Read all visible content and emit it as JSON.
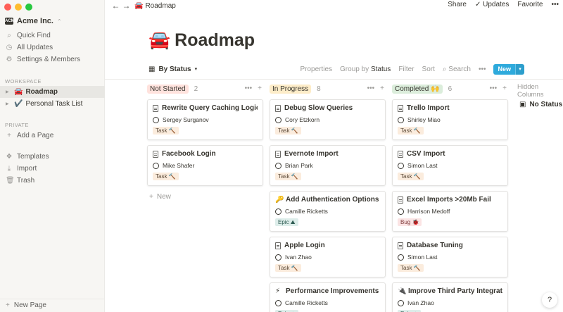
{
  "window": {
    "traffic_colors": [
      "#ff5f57",
      "#febc2e",
      "#28c840"
    ]
  },
  "workspace": {
    "logo": "ACME",
    "name": "Acme Inc.",
    "caret": "⌃"
  },
  "sidebar": {
    "top_items": [
      {
        "icon": "search-icon",
        "glyph": "⌕",
        "label": "Quick Find"
      },
      {
        "icon": "clock-icon",
        "glyph": "◷",
        "label": "All Updates"
      },
      {
        "icon": "gear-icon",
        "glyph": "⚙",
        "label": "Settings & Members"
      }
    ],
    "workspace_label": "WORKSPACE",
    "pages": [
      {
        "emoji": "🚘",
        "label": "Roadmap",
        "active": true
      },
      {
        "emoji": "✔️",
        "label": "Personal Task List",
        "active": false
      }
    ],
    "private_label": "PRIVATE",
    "add_page": "Add a Page",
    "bottom_items": [
      {
        "icon": "templates-icon",
        "glyph": "❖",
        "label": "Templates"
      },
      {
        "icon": "import-icon",
        "glyph": "⤓",
        "label": "Import"
      },
      {
        "icon": "trash-icon",
        "glyph": "🗑",
        "label": "Trash"
      }
    ],
    "new_page": "New Page"
  },
  "topbar": {
    "back": "←",
    "forward": "→",
    "crumb_emoji": "🚘",
    "crumb_label": "Roadmap",
    "share": "Share",
    "updates": "Updates",
    "favorite": "Favorite",
    "more": "•••"
  },
  "page": {
    "emoji": "🚘",
    "title": "Roadmap"
  },
  "view": {
    "tab_label": "By Status",
    "properties": "Properties",
    "group_by_prefix": "Group by",
    "group_by_value": "Status",
    "filter": "Filter",
    "sort": "Sort",
    "search": "Search",
    "more": "•••",
    "new": "New",
    "new_caret": "▾"
  },
  "columns": [
    {
      "name": "Not Started",
      "bg": "#ffe2dd",
      "count": "2",
      "cards": [
        {
          "icon": "doc",
          "title": "Rewrite Query Caching Logic",
          "person": "Sergey Surganov",
          "tag": "Task 🔨",
          "tag_type": "task"
        },
        {
          "icon": "doc",
          "title": "Facebook Login",
          "person": "Mike Shafer",
          "tag": "Task 🔨",
          "tag_type": "task"
        }
      ],
      "new_label": "New"
    },
    {
      "name": "In Progress",
      "bg": "#fdecc8",
      "count": "8",
      "cards": [
        {
          "icon": "doc",
          "title": "Debug Slow Queries",
          "person": "Cory Etzkorn",
          "tag": "Task 🔨",
          "tag_type": "task"
        },
        {
          "icon": "doc",
          "title": "Evernote Import",
          "person": "Brian Park",
          "tag": "Task 🔨",
          "tag_type": "task"
        },
        {
          "icon": "key",
          "emoji": "🔑",
          "title": "Add Authentication Options",
          "person": "Camille Ricketts",
          "tag": "Epic ⛰",
          "tag_type": "epic"
        },
        {
          "icon": "doc",
          "title": "Apple Login",
          "person": "Ivan Zhao",
          "tag": "Task 🔨",
          "tag_type": "task"
        },
        {
          "icon": "bolt",
          "emoji": "⚡",
          "title": "Performance Improvements",
          "person": "Camille Ricketts",
          "tag": "Epic ⛰",
          "tag_type": "epic"
        }
      ]
    },
    {
      "name": "Completed 🙌",
      "bg": "#dbeddb",
      "count": "6",
      "cards": [
        {
          "icon": "doc",
          "title": "Trello Import",
          "person": "Shirley Miao",
          "tag": "Task 🔨",
          "tag_type": "task"
        },
        {
          "icon": "doc",
          "title": "CSV Import",
          "person": "Simon Last",
          "tag": "Task 🔨",
          "tag_type": "task"
        },
        {
          "icon": "doc",
          "title": "Excel Imports >20Mb Fail",
          "person": "Harrison Medoff",
          "tag": "Bug 🐞",
          "tag_type": "bug"
        },
        {
          "icon": "doc",
          "title": "Database Tuning",
          "person": "Simon Last",
          "tag": "Task 🔨",
          "tag_type": "task"
        },
        {
          "icon": "plug",
          "emoji": "🔌",
          "title": "Improve Third Party Integrations",
          "person": "Ivan Zhao",
          "tag": "Epic ⛰",
          "tag_type": "epic"
        }
      ]
    }
  ],
  "hidden_columns": {
    "label": "Hidden Columns",
    "no_status": "No Status"
  },
  "help": "?"
}
